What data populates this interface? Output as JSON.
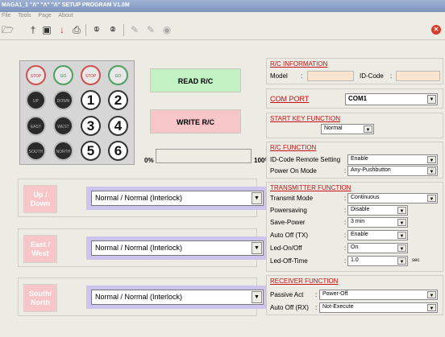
{
  "window": {
    "title": "MAGA1_1 \"Λ\" \"Λ\" \"Λ\" SETUP PROGRAM V1.0M"
  },
  "menu": {
    "items": [
      "File",
      "Tools",
      "Page",
      "About"
    ]
  },
  "remote": {
    "buttons": [
      {
        "label": "STOP",
        "kind": "stop"
      },
      {
        "label": "GO",
        "kind": "go"
      },
      {
        "label": "STOP",
        "kind": "stop"
      },
      {
        "label": "GO",
        "kind": "go"
      },
      {
        "label": "UP",
        "kind": "dark"
      },
      {
        "label": "DOWN",
        "kind": "dark"
      },
      {
        "label": "1",
        "kind": "num"
      },
      {
        "label": "2",
        "kind": "num"
      },
      {
        "label": "EAST",
        "kind": "dark"
      },
      {
        "label": "WEST",
        "kind": "dark"
      },
      {
        "label": "3",
        "kind": "num"
      },
      {
        "label": "4",
        "kind": "num"
      },
      {
        "label": "SOUTH",
        "kind": "dark"
      },
      {
        "label": "NORTH",
        "kind": "dark"
      },
      {
        "label": "5",
        "kind": "num"
      },
      {
        "label": "6",
        "kind": "num"
      }
    ]
  },
  "actions": {
    "read": "READ R/C",
    "write": "WRITE R/C"
  },
  "progress": {
    "min_label": "0%",
    "max_label": "100%",
    "value": 0
  },
  "directions": [
    {
      "button": "Up / Down",
      "value": "Normal / Normal (Interlock)"
    },
    {
      "button": "East / West",
      "value": "Normal / Normal (Interlock)"
    },
    {
      "button": "South/ North",
      "value": "Normal / Normal (Interlock)"
    }
  ],
  "rc_info": {
    "title": "R/C INFORMATION",
    "model_label": "Model",
    "model_value": "",
    "id_label": "ID-Code",
    "id_value": ""
  },
  "com_port": {
    "title": "COM PORT",
    "value": "COM1"
  },
  "start_key": {
    "title": "START KEY FUNCTION",
    "value": "Normal"
  },
  "rc_function": {
    "title": "R/C FUNCTION",
    "rows": [
      {
        "label": "ID-Code Remote Setting",
        "value": "Enable"
      },
      {
        "label": "Power On Mode",
        "value": "Any-Pushbutton"
      }
    ]
  },
  "transmitter": {
    "title": "TRANSMITTER FUNCTION",
    "rows": [
      {
        "label": "Transmit Mode",
        "value": "Continuous",
        "unit": ""
      },
      {
        "label": "Powersaving",
        "value": "Disable",
        "unit": ""
      },
      {
        "label": "Save-Power",
        "value": "3 min",
        "unit": ""
      },
      {
        "label": "Auto Off (TX)",
        "value": "Enable",
        "unit": ""
      },
      {
        "label": "Led-On/Off",
        "value": "On",
        "unit": ""
      },
      {
        "label": "Led-Off-Time",
        "value": "1.0",
        "unit": "sec"
      }
    ]
  },
  "receiver": {
    "title": "RECEIVER FUNCTION",
    "rows": [
      {
        "label": "Passive Act",
        "value": "Power-Off"
      },
      {
        "label": "Auto Off (RX)",
        "value": "Not-Execute"
      }
    ]
  },
  "icons": [
    "folder-open-icon",
    "pin-icon",
    "save-icon",
    "download-icon",
    "print-icon",
    "zero-one-icon",
    "zero-two-icon",
    "pencil-icon",
    "pencil-edit-icon",
    "record-icon",
    "close-icon"
  ]
}
